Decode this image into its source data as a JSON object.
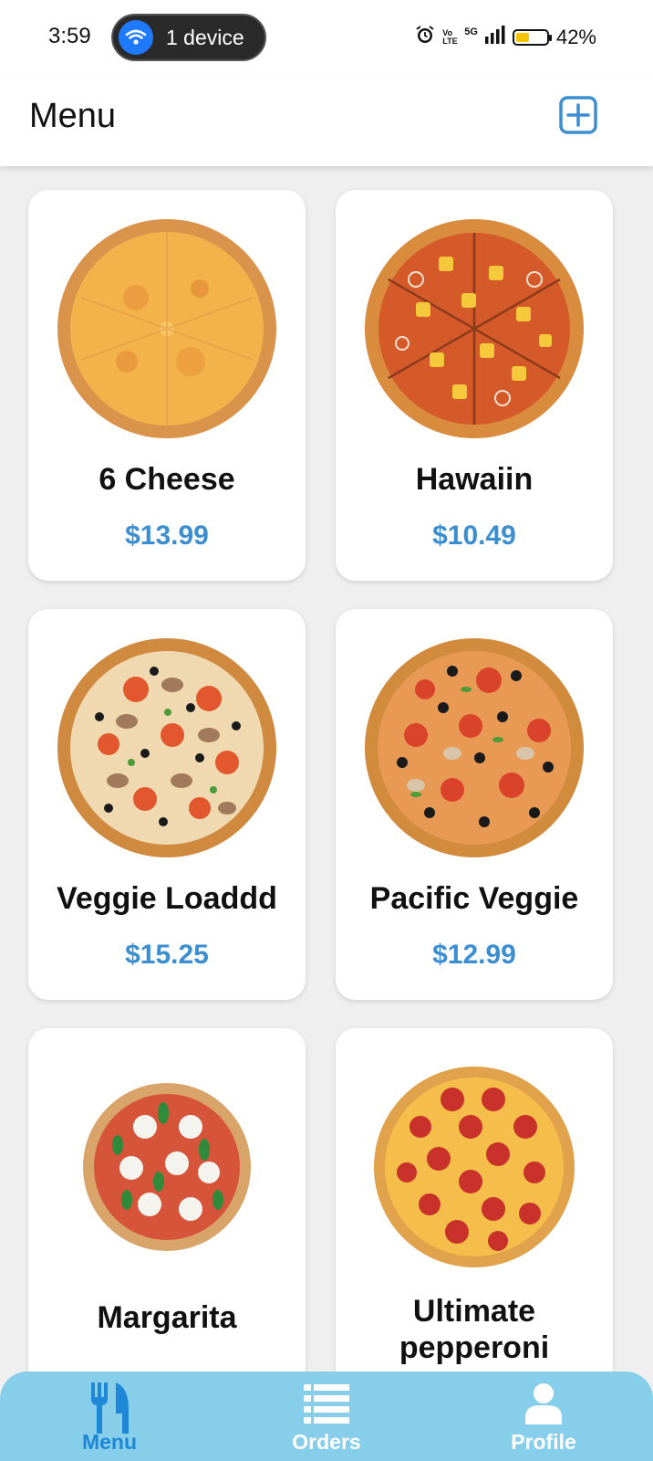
{
  "status_bar": {
    "time": "3:59",
    "device_label": "1 device",
    "battery_percent": "42%",
    "network": "5G",
    "network_type": "Vo LTE"
  },
  "header": {
    "title": "Menu",
    "add_icon": "plus-square-icon"
  },
  "menu_items": [
    {
      "name": "6 Cheese",
      "price": "$13.99",
      "image": "cheese-pizza"
    },
    {
      "name": "Hawaiin",
      "price": "$10.49",
      "image": "hawaiian-pizza"
    },
    {
      "name": "Veggie Loaddd",
      "price": "$15.25",
      "image": "veggie-pizza"
    },
    {
      "name": "Pacific Veggie",
      "price": "$12.99",
      "image": "pacific-veggie-pizza"
    },
    {
      "name": "Margarita",
      "price": "",
      "image": "margherita-pizza"
    },
    {
      "name": "Ultimate pepperoni",
      "price": "",
      "image": "pepperoni-pizza"
    }
  ],
  "bottom_nav": {
    "items": [
      {
        "label": "Menu",
        "icon": "fork-knife-icon",
        "active": true
      },
      {
        "label": "Orders",
        "icon": "list-icon",
        "active": false
      },
      {
        "label": "Profile",
        "icon": "user-icon",
        "active": false
      }
    ]
  },
  "colors": {
    "accent": "#3b8fd0",
    "nav_background": "#87ceeb",
    "page_background": "#efefef"
  }
}
